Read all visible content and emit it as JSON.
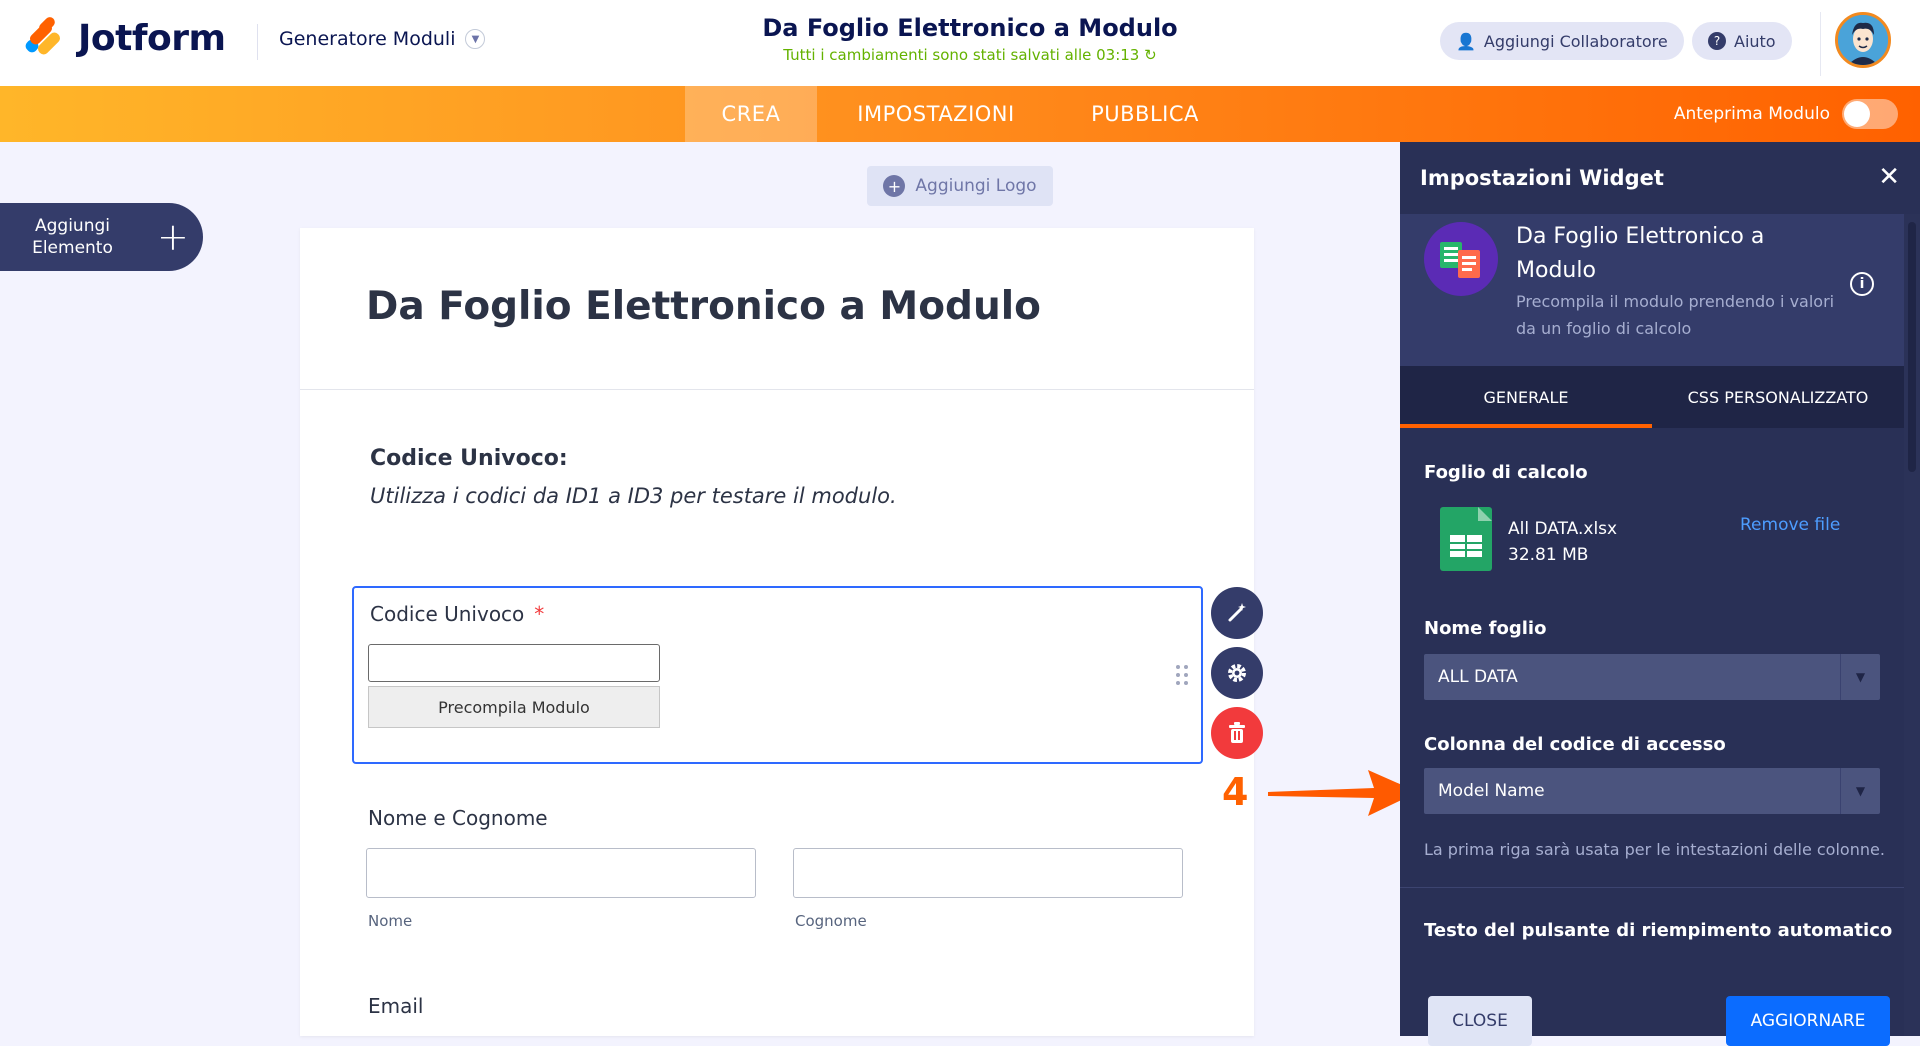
{
  "header": {
    "logo_text": "Jotform",
    "builder_menu_label": "Generatore Moduli",
    "form_title": "Da Foglio Elettronico a Modulo",
    "save_status": "Tutti i cambiamenti sono stati salvati alle 03:13",
    "add_collaborator_label": "Aggiungi Collaboratore",
    "help_label": "Aiuto"
  },
  "navbar": {
    "tabs": [
      {
        "label": "CREA",
        "active": true
      },
      {
        "label": "IMPOSTAZIONI",
        "active": false
      },
      {
        "label": "PUBBLICA",
        "active": false
      }
    ],
    "preview_label": "Anteprima Modulo",
    "preview_enabled": false,
    "accent_color": "#ff6100"
  },
  "left": {
    "add_element_line1": "Aggiungi",
    "add_element_line2": "Elemento"
  },
  "canvas": {
    "add_logo_label": "Aggiungi Logo",
    "form_heading": "Da Foglio Elettronico a Modulo",
    "intro_title": "Codice Univoco:",
    "intro_text": "Utilizza i codici da ID1 a ID3 per testare il modulo.",
    "field_code": {
      "label": "Codice Univoco",
      "required_mark": "*",
      "value": "",
      "button_label": "Precompila Modulo"
    },
    "field_name": {
      "label": "Nome e Cognome",
      "first_sublabel": "Nome",
      "last_sublabel": "Cognome",
      "first_value": "",
      "last_value": ""
    },
    "field_email": {
      "label": "Email"
    },
    "step_number": "4"
  },
  "panel": {
    "title": "Impostazioni Widget",
    "widget_name": "Da Foglio Elettronico a Modulo",
    "widget_description": "Precompila il modulo prendendo i valori da un foglio di calcolo",
    "tabs": [
      {
        "label": "GENERALE",
        "active": true
      },
      {
        "label": "CSS PERSONALIZZATO",
        "active": false
      }
    ],
    "spreadsheet_label": "Foglio di calcolo",
    "file_name": "All DATA.xlsx",
    "file_size": "32.81 MB",
    "remove_file_label": "Remove file",
    "sheet_name_label": "Nome foglio",
    "sheet_name_value": "ALL DATA",
    "access_column_label": "Colonna del codice di accesso",
    "access_column_value": "Model Name",
    "header_hint": "La prima riga sarà usata per le intestazioni delle colonne.",
    "autofill_button_text_label": "Testo del pulsante di riempimento automatico",
    "close_label": "CLOSE",
    "update_label": "AGGIORNARE"
  }
}
